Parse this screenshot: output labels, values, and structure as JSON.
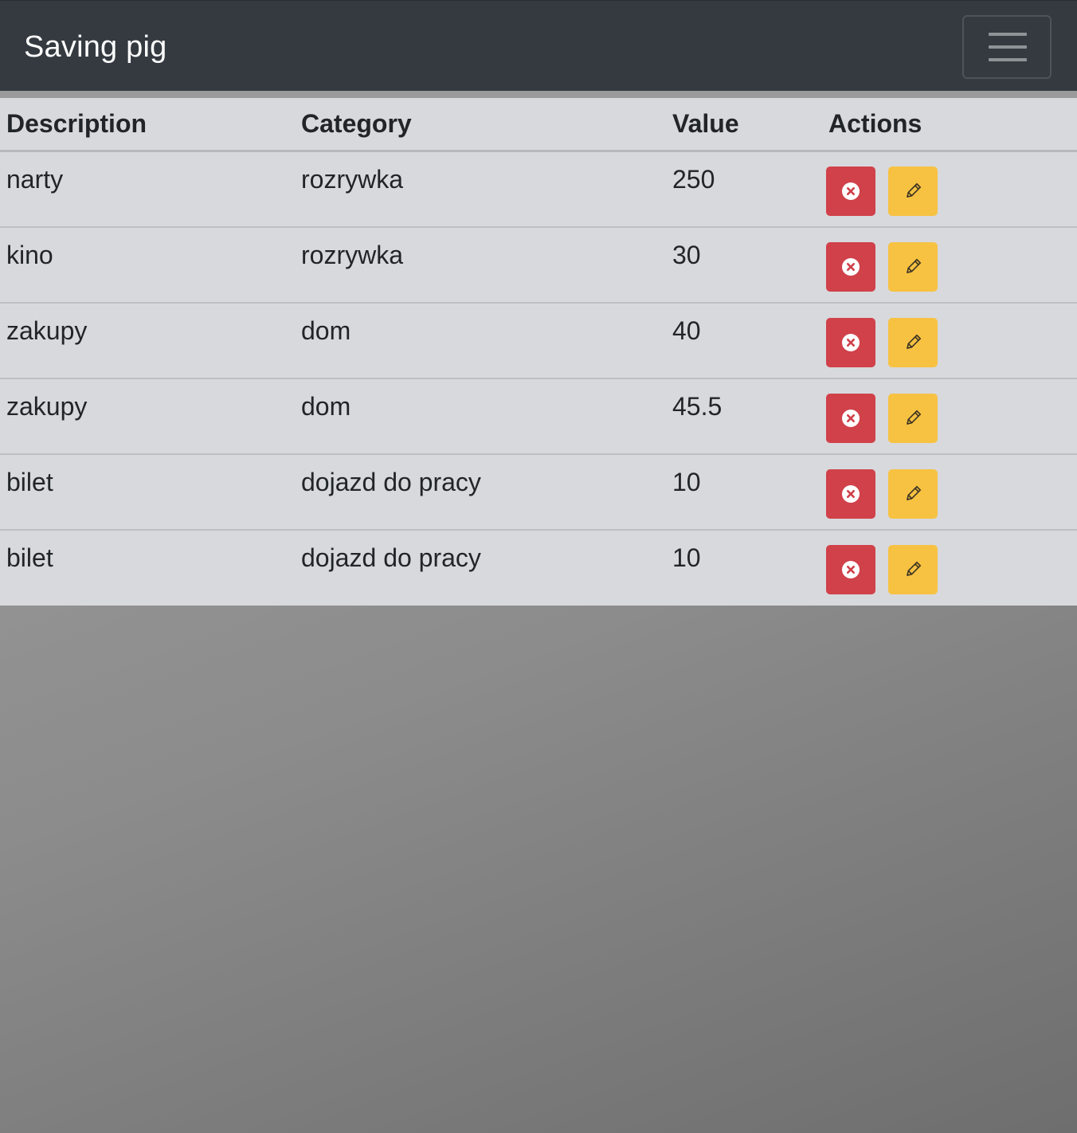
{
  "navbar": {
    "brand": "Saving pig",
    "toggler_icon": "hamburger-menu-icon"
  },
  "table": {
    "headers": {
      "description": "Description",
      "category": "Category",
      "value": "Value",
      "actions": "Actions"
    },
    "rows": [
      {
        "description": "narty",
        "category": "rozrywka",
        "value": "250"
      },
      {
        "description": "kino",
        "category": "rozrywka",
        "value": "30"
      },
      {
        "description": "zakupy",
        "category": "dom",
        "value": "40"
      },
      {
        "description": "zakupy",
        "category": "dom",
        "value": "45.5"
      },
      {
        "description": "bilet",
        "category": "dojazd do pracy",
        "value": "10"
      },
      {
        "description": "bilet",
        "category": "dojazd do pracy",
        "value": "10"
      }
    ],
    "actions": {
      "delete_icon": "x-circle-icon",
      "edit_icon": "pencil-icon"
    }
  },
  "colors": {
    "navbar_bg": "#343a40",
    "delete_button": "#d0414a",
    "edit_button": "#f7c242",
    "table_bg": "#d8d9dc"
  }
}
